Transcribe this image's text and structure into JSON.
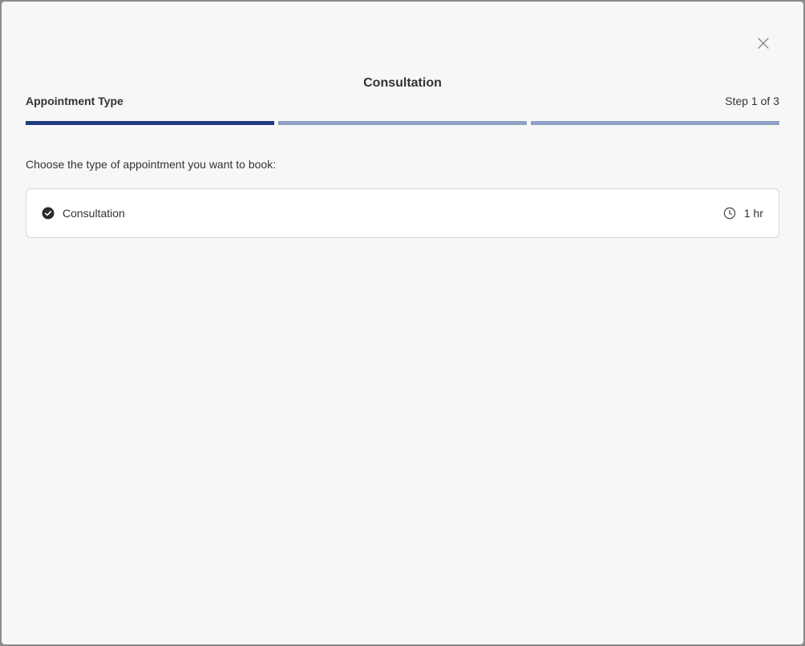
{
  "modal": {
    "title": "Consultation",
    "close_icon": "close-icon"
  },
  "steps": {
    "current_label": "Appointment Type",
    "counter": "Step 1 of 3",
    "total": 3,
    "current": 1
  },
  "prompt": "Choose the type of appointment you want to book:",
  "options": [
    {
      "name": "Consultation",
      "duration": "1 hr",
      "selected": true,
      "icon": "check-circle-icon",
      "duration_icon": "clock-icon"
    }
  ],
  "colors": {
    "progress_active": "#1f3b80",
    "progress_inactive": "#8ea1c4",
    "background": "#f7f7f7",
    "text": "#333333"
  }
}
